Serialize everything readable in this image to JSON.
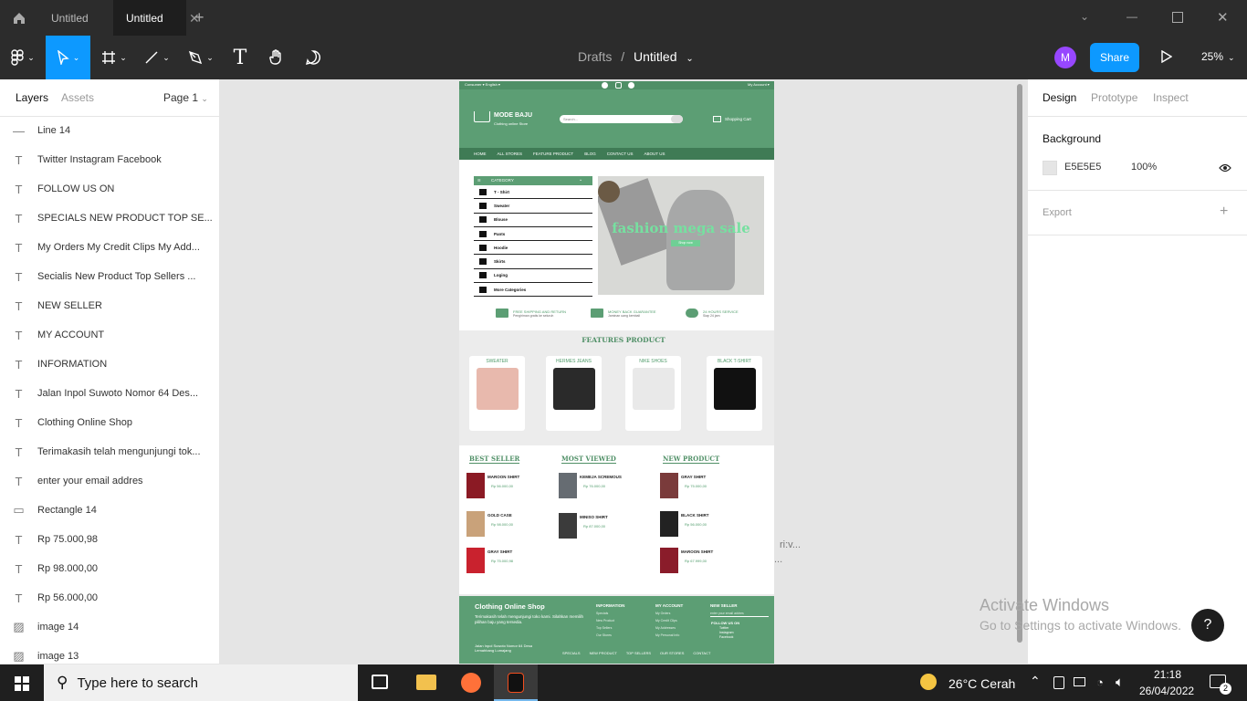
{
  "titlebar": {
    "tabs": [
      "Untitled",
      "Untitled"
    ]
  },
  "toolbar": {
    "breadcrumb_root": "Drafts",
    "breadcrumb_sep": "/",
    "file_name": "Untitled",
    "avatar": "M",
    "share": "Share",
    "zoom": "25%"
  },
  "left": {
    "tabs": [
      "Layers",
      "Assets"
    ],
    "page": "Page 1",
    "layers": [
      {
        "icon": "line-icon",
        "name": "Line 14"
      },
      {
        "icon": "text-icon",
        "name": "Twitter Instagram Facebook"
      },
      {
        "icon": "text-icon",
        "name": "FOLLOW US ON"
      },
      {
        "icon": "text-icon",
        "name": "SPECIALS NEW PRODUCT TOP SE..."
      },
      {
        "icon": "text-icon",
        "name": "My Orders My Credit Clips My Add..."
      },
      {
        "icon": "text-icon",
        "name": "Secialis New Product Top Sellers ..."
      },
      {
        "icon": "text-icon",
        "name": "NEW SELLER"
      },
      {
        "icon": "text-icon",
        "name": "MY ACCOUNT"
      },
      {
        "icon": "text-icon",
        "name": "INFORMATION"
      },
      {
        "icon": "text-icon",
        "name": "Jalan Inpol Suwoto Nomor 64 Des..."
      },
      {
        "icon": "text-icon",
        "name": "Clothing Online Shop"
      },
      {
        "icon": "text-icon",
        "name": "Terimakasih telah mengunjungi tok..."
      },
      {
        "icon": "text-icon",
        "name": "enter your email addres"
      },
      {
        "icon": "rect-icon",
        "name": "Rectangle 14"
      },
      {
        "icon": "text-icon",
        "name": "Rp 75.000,98"
      },
      {
        "icon": "text-icon",
        "name": "Rp 98.000,00"
      },
      {
        "icon": "text-icon",
        "name": "Rp 56.000,00"
      },
      {
        "icon": "image-icon",
        "name": "image 14"
      },
      {
        "icon": "image-icon",
        "name": "image 13"
      }
    ]
  },
  "right": {
    "tabs": [
      "Design",
      "Prototype",
      "Inspect"
    ],
    "background_label": "Background",
    "bg_hex": "E5E5E5",
    "bg_opacity": "100%",
    "export": "Export",
    "bg_color": "#e5e5e5"
  },
  "canvas": {
    "stray1": "ri:v...",
    "stray2": "...",
    "watermark_title": "Activate Windows",
    "watermark_sub": "Go to Settings to activate Windows.",
    "help": "?"
  },
  "design": {
    "brand": "MODE BAJU",
    "brand_sub": "Clothing online Store",
    "search": "Search...",
    "cart": "Shopping Cart",
    "nav": [
      "HOME",
      "ALL STORES",
      "FEATURE PRODUCT",
      "BLOG",
      "CONTACT US",
      "ABOUT US"
    ],
    "category_title": "CATEGORY",
    "categories": [
      "T - Shirt",
      "Sweater",
      "Blouse",
      "Pants",
      "Hoodie",
      "Skirts",
      "Loging",
      "More Categories"
    ],
    "banner": "fashion mega sale",
    "banner_btn": "Shop now",
    "services": [
      {
        "t": "FREE SHIPPING AND RETURN",
        "s": "Pengiriman gratis ke seluruh"
      },
      {
        "t": "MONEY BACK GUARANTEE",
        "s": "Jaminan uang kembali"
      },
      {
        "t": "24 HOURS SERVICE",
        "s": "Siap 24 jam"
      }
    ],
    "features_title": "FEATURES PRODUCT",
    "features": [
      "SWEATER",
      "HERMES JEANS",
      "NIKE SHOES",
      "BLACK T-SHIRT"
    ],
    "col_titles": [
      "BEST SELLER",
      "MOST VIEWED",
      "NEW PRODUCT"
    ],
    "best": [
      {
        "n": "MAROON SHIRT",
        "p": "Rp 56.000,00"
      },
      {
        "n": "GOLD CASE",
        "p": "Rp 98.000,00"
      },
      {
        "n": "GRAY SHIRT",
        "p": "Rp 75.000,98"
      }
    ],
    "most": [
      {
        "n": "KEMEJA SCREMOUS",
        "p": "Rp 76.000,00"
      },
      {
        "n": "MINISO SHIRT",
        "p": "Rp 87.000,00"
      }
    ],
    "newp": [
      {
        "n": "GRAY SHIRT",
        "p": "Rp 75.000,00"
      },
      {
        "n": "BLACK SHIRT",
        "p": "Rp 56.000,00"
      },
      {
        "n": "MAROON SHIRT",
        "p": "Rp 67.999,00"
      }
    ],
    "footer_brand": "Clothing Online Shop",
    "footer_desc": "Terimakasih telah mengunjungi toko kami. Silahkan memilih pilihan baju yang tersedia.",
    "footer_addr": "Jalan Inpol Suwoto Nomor 64 Desa Lemahbang Lumajang",
    "info_title": "INFORMATION",
    "info_items": [
      "Specials",
      "New Product",
      "Top Sellers",
      "Our Stores"
    ],
    "acc_title": "MY ACCOUNT",
    "acc_items": [
      "My Orders",
      "My Credit Clips",
      "My Addresses",
      "My Personal Info"
    ],
    "seller_title": "NEW SELLER",
    "email_ph": "enter your email addres",
    "follow": "FOLLOW US ON",
    "social": [
      "Twitter",
      "Instagram",
      "Facebook"
    ],
    "bottom_links": [
      "SPECIALS",
      "NEW PRODUCT",
      "TOP SELLERS",
      "OUR STORES",
      "CONTACT"
    ]
  },
  "taskbar": {
    "search": "Type here to search",
    "weather": "26°C  Cerah",
    "time": "21:18",
    "date": "26/04/2022",
    "notif": "2"
  }
}
